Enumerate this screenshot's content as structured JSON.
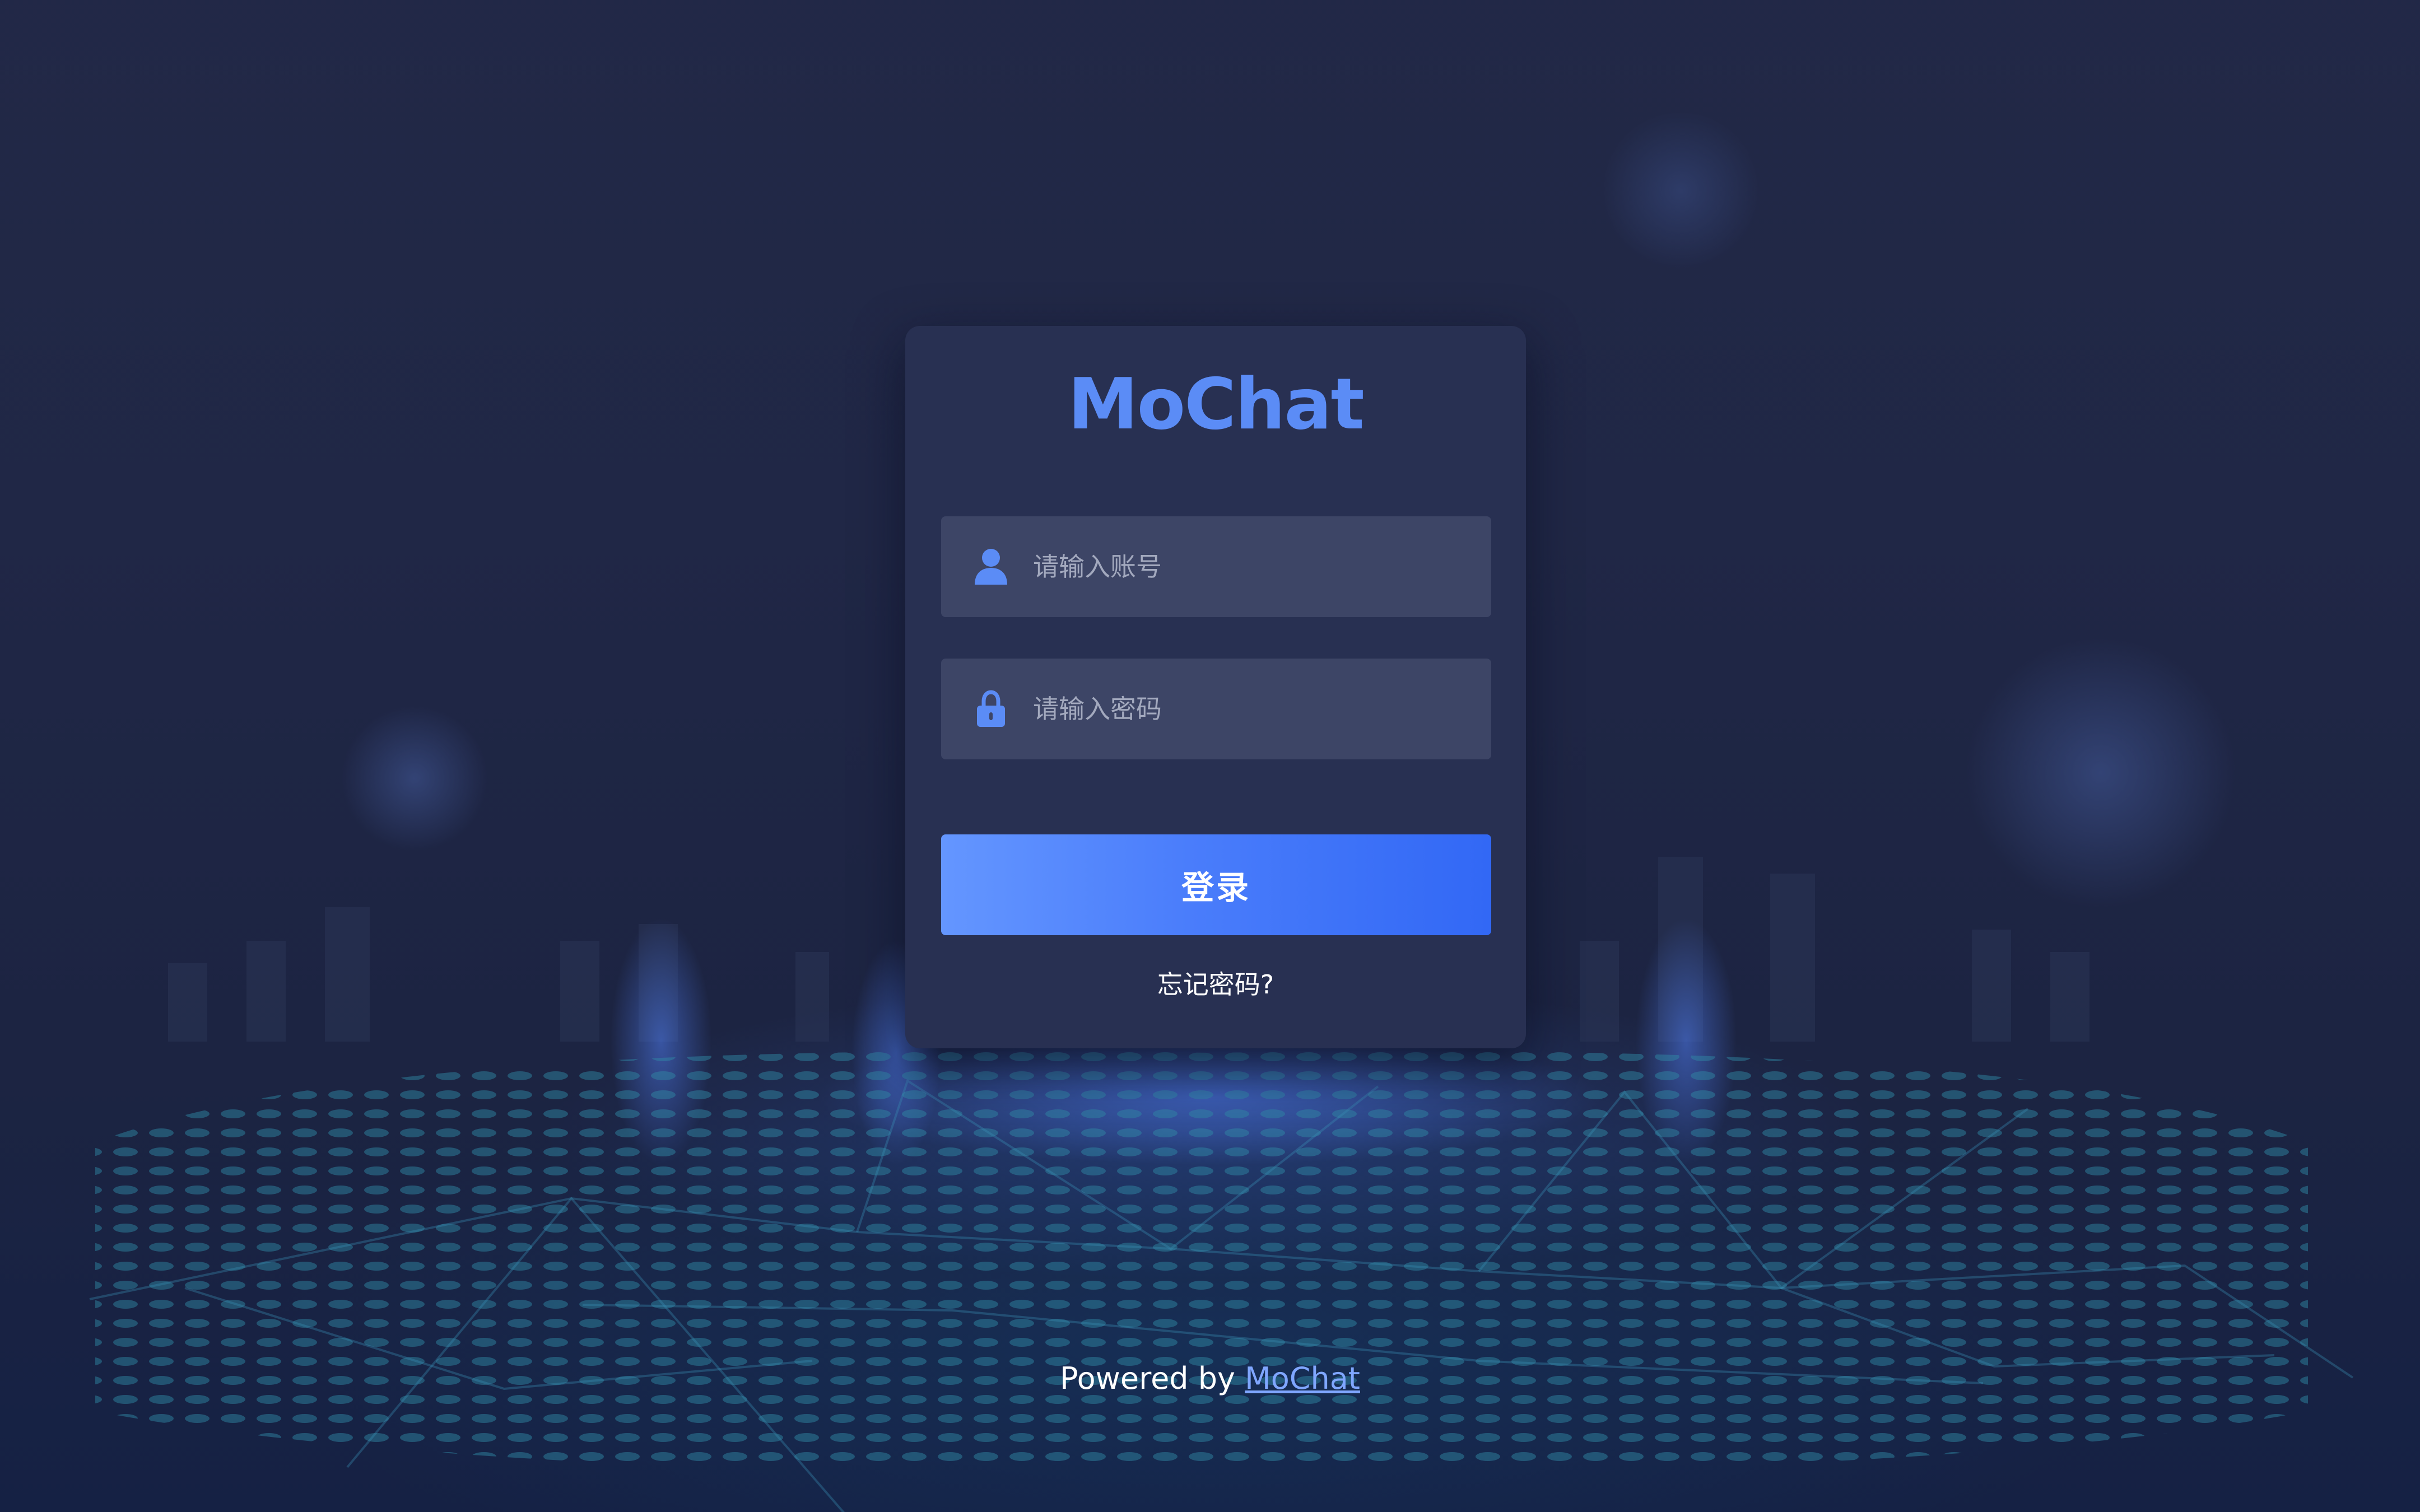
{
  "brand": {
    "logo_text": "MoChat",
    "accent_color": "#5b8cf6"
  },
  "login_form": {
    "account_placeholder": "请输入账号",
    "password_placeholder": "请输入密码",
    "account_icon": "user-icon",
    "password_icon": "lock-icon",
    "submit_label": "登录",
    "forgot_password_label": "忘记密码?"
  },
  "footer": {
    "powered_by_label": "Powered by",
    "link_text": "MoChat"
  }
}
